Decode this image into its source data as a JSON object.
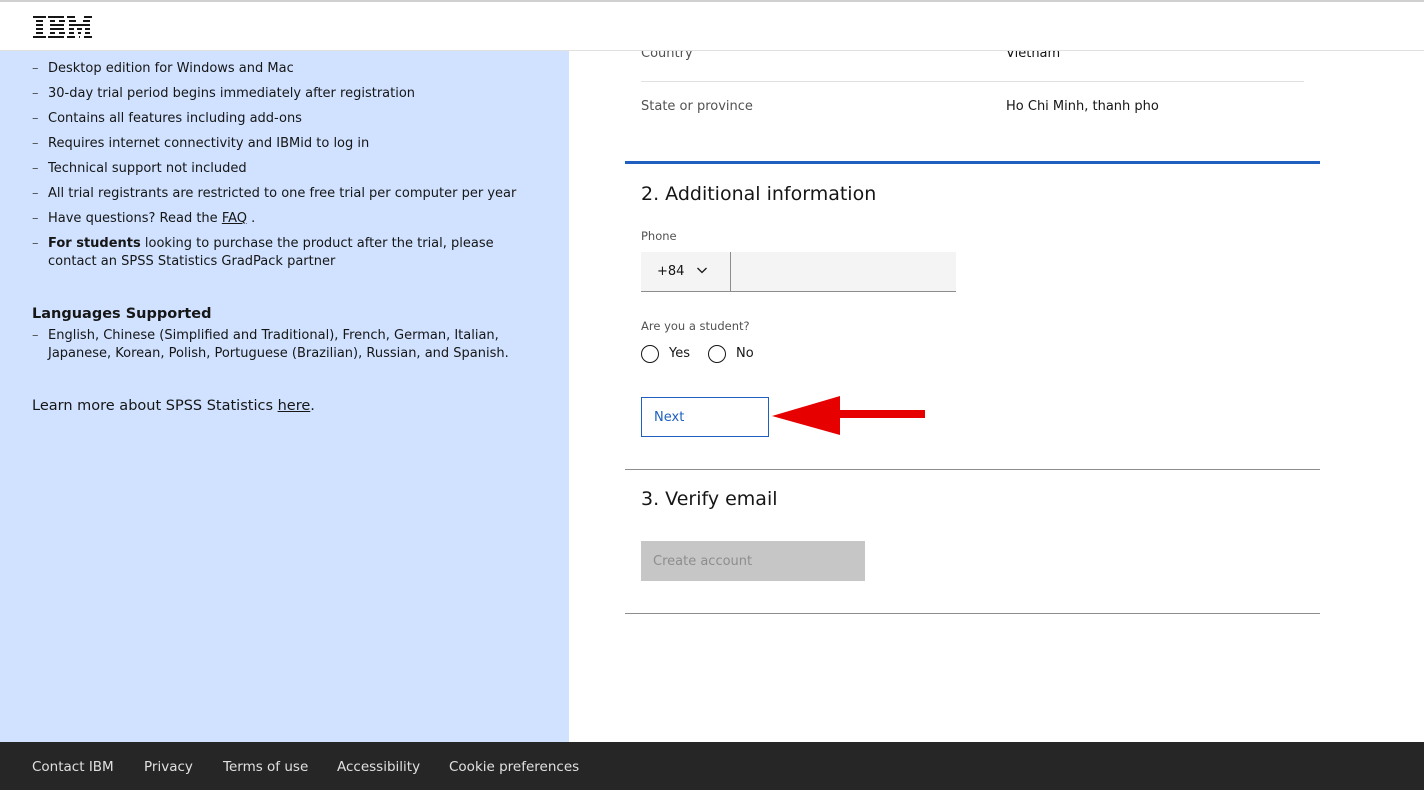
{
  "header": {
    "logo_text": "IBM"
  },
  "left_panel": {
    "bullets": [
      {
        "text": "Desktop edition for Windows and Mac"
      },
      {
        "text": "30-day trial period begins immediately after registration"
      },
      {
        "text": "Contains all features including add-ons"
      },
      {
        "text": "Requires internet connectivity and IBMid to log in"
      },
      {
        "text": "Technical support not included"
      },
      {
        "text": "All trial registrants are restricted to one free trial per computer per year"
      },
      {
        "prefix": "Have questions? Read the ",
        "link": "FAQ",
        "suffix": " ."
      },
      {
        "bold": "For students",
        "text": " looking to purchase the product after the trial, please contact an SPSS Statistics GradPack partner"
      }
    ],
    "languages_title": "Languages Supported",
    "languages_text": "English, Chinese (Simplified and Traditional), French, German, Italian, Japanese, Korean, Polish, Portuguese (Brazilian), Russian, and Spanish.",
    "learn_more_prefix": "Learn more about SPSS Statistics ",
    "learn_more_link": "here",
    "learn_more_suffix": "."
  },
  "form": {
    "country_label": "Country",
    "country_value": "Vietnam",
    "state_label": "State or province",
    "state_value": "Ho Chi Minh, thanh pho",
    "section2_title": "2. Additional information",
    "phone_label": "Phone",
    "phone_country_code": "+84",
    "phone_value": "",
    "student_question": "Are you a student?",
    "radio_yes": "Yes",
    "radio_no": "No",
    "next_label": "Next",
    "section3_title": "3. Verify email",
    "create_account_label": "Create account"
  },
  "footer": {
    "links": [
      "Contact IBM",
      "Privacy",
      "Terms of use",
      "Accessibility",
      "Cookie preferences"
    ]
  },
  "colors": {
    "left_panel_bg": "#d0e2ff",
    "accent": "#1f5fbf",
    "annotation_arrow": "#e60000",
    "footer_bg": "#262626"
  },
  "icons": [
    "ibm-logo",
    "chevron-down-icon",
    "red-arrow-annotation"
  ]
}
